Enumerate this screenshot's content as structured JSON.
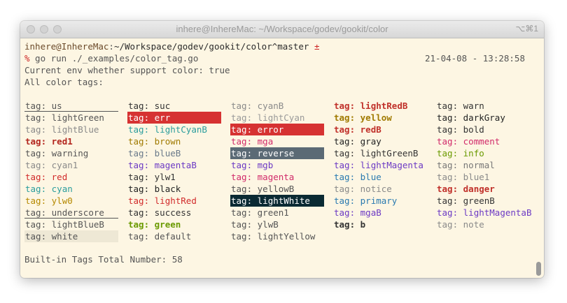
{
  "window": {
    "title": "inhere@InhereMac: ~/Workspace/godev/gookit/color",
    "shortcut": "⌥⌘1"
  },
  "terminal": {
    "prompt_user": "inhere",
    "prompt_at": "@",
    "prompt_host": "InhereMac",
    "prompt_colon": ":",
    "prompt_path": "~/Workspace/godev/gookit/color",
    "prompt_branch": "^master",
    "prompt_dirty": " ±",
    "prompt_symbol": "%",
    "command": " go run ./_examples/color_tag.go",
    "timestamp": "21-04-08 - 13:28:58",
    "line_env": "Current env whether support color: true",
    "line_all": "All color tags:",
    "line_total": "Built-in Tags Total Number: 58"
  },
  "colors": {
    "prompt": "#6b4a2a",
    "path": "#2b2b2b",
    "dirty": "#cc2222",
    "symbol": "#cc2222",
    "default": "#555555"
  },
  "tag_prefix": "tag: ",
  "tag_columns": [
    [
      {
        "name": "us",
        "fg": "#555555",
        "underline": true
      },
      {
        "name": "lightGreen",
        "fg": "#555555"
      },
      {
        "name": "lightBlue",
        "fg": "#8a8a8a"
      },
      {
        "name": "red1",
        "fg": "#b3261e",
        "bold": true
      },
      {
        "name": "warning",
        "fg": "#555555"
      },
      {
        "name": "cyan1",
        "fg": "#8a8a8a"
      },
      {
        "name": "red",
        "fg": "#d12a2a"
      },
      {
        "name": "cyan",
        "fg": "#2a9d9d"
      },
      {
        "name": "ylw0",
        "fg": "#b58900"
      },
      {
        "name": "underscore",
        "fg": "#555555",
        "underline": true
      },
      {
        "name": "lightBlueB",
        "fg": "#555555"
      },
      {
        "name": "white",
        "fg": "#555555",
        "bg": "#eee8d5"
      }
    ],
    [
      {
        "name": "suc",
        "fg": "#333333"
      },
      {
        "name": "err",
        "fg": "#ffffff",
        "bg": "#d63232"
      },
      {
        "name": "lightCyanB",
        "fg": "#2a9d9d"
      },
      {
        "name": "brown",
        "fg": "#a07a00"
      },
      {
        "name": "blueB",
        "fg": "#6a7a8a"
      },
      {
        "name": "magentaB",
        "fg": "#6c3ac4"
      },
      {
        "name": "ylw1",
        "fg": "#333333"
      },
      {
        "name": "black",
        "fg": "#222222"
      },
      {
        "name": "lightRed",
        "fg": "#d12a2a"
      },
      {
        "name": "success",
        "fg": "#333333"
      },
      {
        "name": "green",
        "fg": "#6a9a00",
        "bold": true
      },
      {
        "name": "default",
        "fg": "#555555"
      }
    ],
    [
      {
        "name": "cyanB",
        "fg": "#8a8a8a"
      },
      {
        "name": "lightCyan",
        "fg": "#9a9a9a"
      },
      {
        "name": "error",
        "fg": "#ffffff",
        "bg": "#d63232"
      },
      {
        "name": "mga",
        "fg": "#d12a6a"
      },
      {
        "name": "reverse",
        "fg": "#ffffff",
        "bg": "#5b6a75"
      },
      {
        "name": "mgb",
        "fg": "#6c3ac4"
      },
      {
        "name": "magenta",
        "fg": "#d12a6a"
      },
      {
        "name": "yellowB",
        "fg": "#555555"
      },
      {
        "name": "lightWhite",
        "fg": "#ffffff",
        "bg": "#0a2a33"
      },
      {
        "name": "green1",
        "fg": "#555555"
      },
      {
        "name": "ylwB",
        "fg": "#555555"
      },
      {
        "name": "lightYellow",
        "fg": "#555555"
      }
    ],
    [
      {
        "name": "lightRedB",
        "fg": "#c0302a",
        "bold": true
      },
      {
        "name": "yellow",
        "fg": "#a07a00",
        "bold": true
      },
      {
        "name": "redB",
        "fg": "#c0302a",
        "bold": true
      },
      {
        "name": "gray",
        "fg": "#222222"
      },
      {
        "name": "lightGreenB",
        "fg": "#333333"
      },
      {
        "name": "lightMagenta",
        "fg": "#6c3ac4"
      },
      {
        "name": "blue",
        "fg": "#2a7ab0"
      },
      {
        "name": "notice",
        "fg": "#8a8a8a"
      },
      {
        "name": "primary",
        "fg": "#2a7ab0"
      },
      {
        "name": "mgaB",
        "fg": "#6c3ac4"
      },
      {
        "name": "b",
        "fg": "#333333",
        "bold": true
      }
    ],
    [
      {
        "name": "warn",
        "fg": "#333333"
      },
      {
        "name": "darkGray",
        "fg": "#222222"
      },
      {
        "name": "bold",
        "fg": "#333333"
      },
      {
        "name": "comment",
        "fg": "#d12a6a"
      },
      {
        "name": "info",
        "fg": "#6a9a00"
      },
      {
        "name": "normal",
        "fg": "#777777"
      },
      {
        "name": "blue1",
        "fg": "#8a8a8a"
      },
      {
        "name": "danger",
        "fg": "#c0302a",
        "bold": true
      },
      {
        "name": "greenB",
        "fg": "#333333"
      },
      {
        "name": "lightMagentaB",
        "fg": "#6c3ac4"
      },
      {
        "name": "note",
        "fg": "#8a8a8a"
      }
    ]
  ]
}
